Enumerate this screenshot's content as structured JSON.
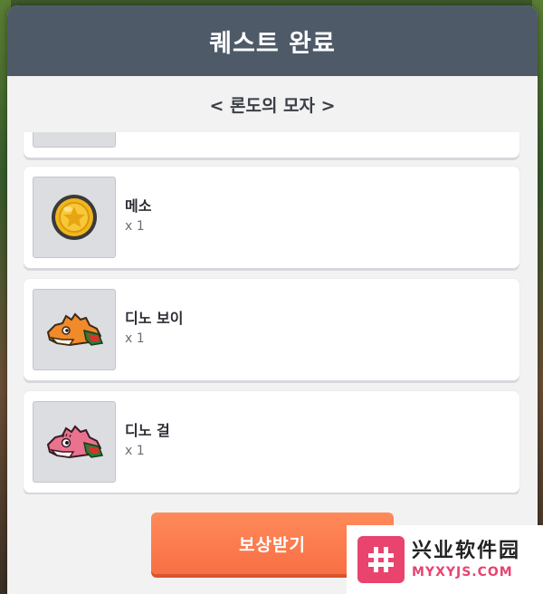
{
  "dialog": {
    "title": "퀘스트 완료",
    "subtitle": "< 론도의 모자 >"
  },
  "rewards": [
    {
      "name": "메소",
      "qty": "x 1",
      "icon": "meso-coin-icon"
    },
    {
      "name": "디노 보이",
      "qty": "x 1",
      "icon": "dino-boy-icon"
    },
    {
      "name": "디노 걸",
      "qty": "x 1",
      "icon": "dino-girl-icon"
    }
  ],
  "claim_button": {
    "label": "보상받기"
  },
  "watermark": {
    "cn_text": "兴业软件园",
    "url_text": "MYXYJS.COM"
  },
  "colors": {
    "title_bar": "#4e5a68",
    "dialog_bg": "#f2f2f2",
    "card_bg": "#ffffff",
    "claim_button": "#f86f45",
    "coin_gold": "#f2b51c",
    "dino_orange": "#f08a2a",
    "dino_pink": "#e9738f",
    "watermark_accent": "#e8446e"
  }
}
